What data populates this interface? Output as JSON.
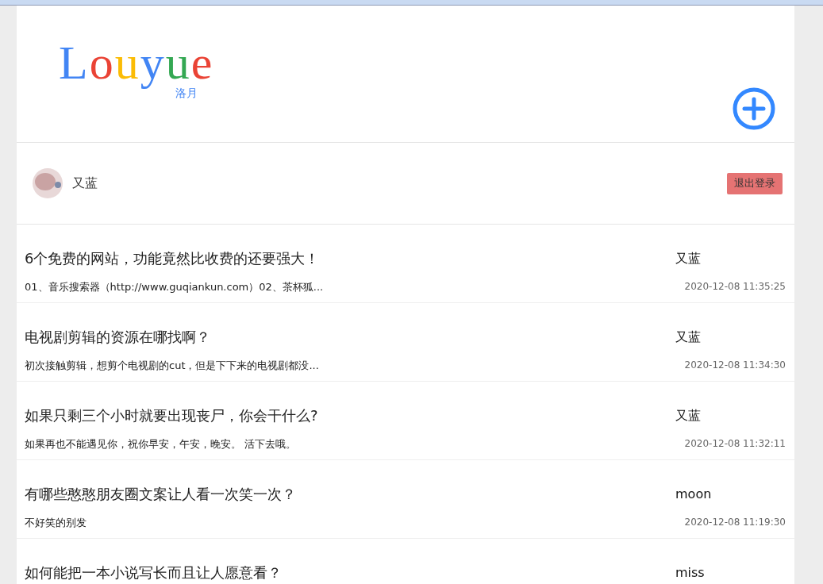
{
  "logo": {
    "letters": [
      {
        "char": "L",
        "color": "#4285f4"
      },
      {
        "char": "o",
        "color": "#ea4335"
      },
      {
        "char": "u",
        "color": "#fbbc05"
      },
      {
        "char": "y",
        "color": "#4285f4"
      },
      {
        "char": "u",
        "color": "#34a853"
      },
      {
        "char": "e",
        "color": "#ea4335"
      }
    ],
    "subtitle": "洛月"
  },
  "user": {
    "name": "又蓝",
    "logout": "退出登录"
  },
  "posts": [
    {
      "title": "6个免费的网站，功能竟然比收费的还要强大！",
      "author": "又蓝",
      "excerpt": "01、音乐搜索器（http://www.guqiankun.com）02、茶杯狐...",
      "time": "2020-12-08 11:35:25"
    },
    {
      "title": "电视剧剪辑的资源在哪找啊？",
      "author": "又蓝",
      "excerpt": "初次接触剪辑，想剪个电视剧的cut，但是下下来的电视剧都没...",
      "time": "2020-12-08 11:34:30"
    },
    {
      "title": "如果只剩三个小时就要出现丧尸，你会干什么?",
      "author": "又蓝",
      "excerpt": "如果再也不能遇见你，祝你早安，午安，晚安。 活下去哦。",
      "time": "2020-12-08 11:32:11"
    },
    {
      "title": "有哪些憨憨朋友圈文案让人看一次笑一次？",
      "author": "moon",
      "excerpt": "不好笑的别发",
      "time": "2020-12-08 11:19:30"
    },
    {
      "title": "如何能把一本小说写长而且让人愿意看？",
      "author": "miss"
    }
  ]
}
